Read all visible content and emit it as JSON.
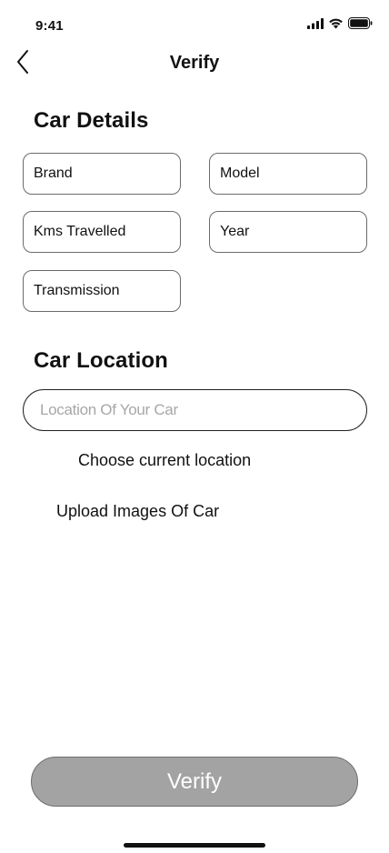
{
  "status_bar": {
    "time": "9:41",
    "icons": [
      "cellular-signal-icon",
      "wifi-icon",
      "battery-icon"
    ]
  },
  "header": {
    "back_icon": "chevron-left-icon",
    "title": "Verify"
  },
  "car_details": {
    "title": "Car Details",
    "fields": {
      "brand": "Brand",
      "model": "Model",
      "kms_travelled": "Kms Travelled",
      "year": "Year",
      "transmission": "Transmission"
    }
  },
  "car_location": {
    "title": "Car Location",
    "input_placeholder": "Location Of Your Car",
    "input_value": "",
    "choose_current_location": "Choose current location"
  },
  "upload_images": "Upload Images Of Car",
  "verify_button": "Verify",
  "colors": {
    "button_fill": "#a3a3a3",
    "button_text": "#ffffff",
    "placeholder": "#a7a7a7",
    "field_border": "#6b6b6b"
  }
}
